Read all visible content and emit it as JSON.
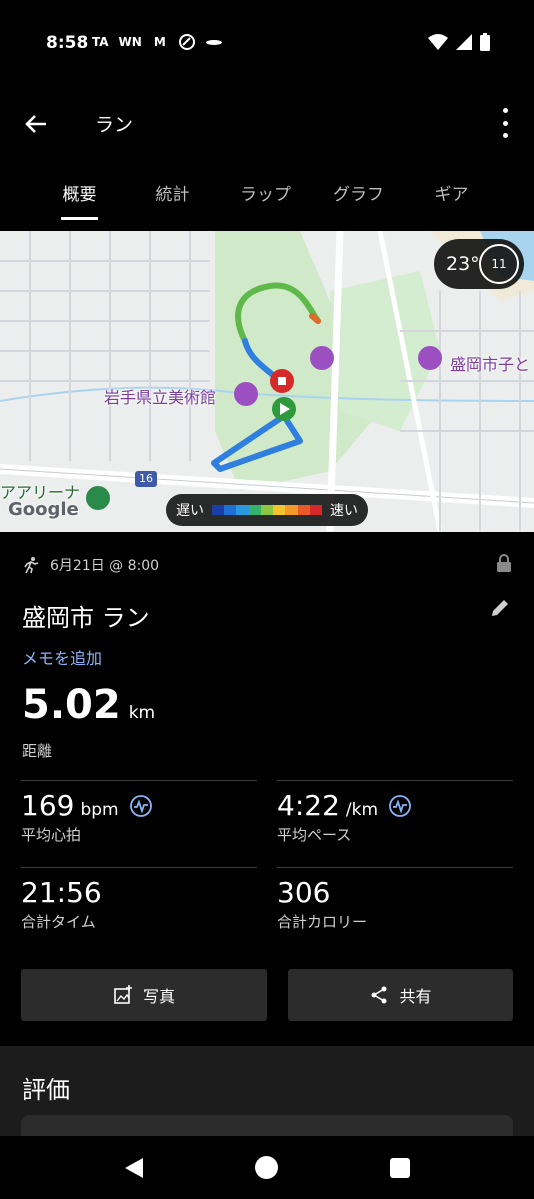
{
  "status_bar": {
    "time": "8:58",
    "icons_left": [
      "TA",
      "WN",
      "M"
    ],
    "icons_right": [
      "wifi-icon",
      "signal-icon",
      "battery-icon"
    ]
  },
  "app_bar": {
    "title": "ラン"
  },
  "tabs": [
    {
      "label": "概要",
      "active": true
    },
    {
      "label": "統計",
      "active": false
    },
    {
      "label": "ラップ",
      "active": false
    },
    {
      "label": "グラフ",
      "active": false
    },
    {
      "label": "ギア",
      "active": false
    }
  ],
  "map": {
    "weather_temp": "23°",
    "weather_dial": "11",
    "labels": {
      "museum": "岩手県立美術館",
      "city_right": "盛岡市子と",
      "arena": "アアリーナ",
      "route_number": "16"
    },
    "google_logo": "Google",
    "speed_legend": {
      "slow": "遅い",
      "fast": "速い",
      "colors": [
        "#1b3ea8",
        "#1f6fd6",
        "#2a9ae0",
        "#36b36a",
        "#8cc63f",
        "#f4c430",
        "#f39a2b",
        "#e85a2a",
        "#d62a2a"
      ]
    },
    "route_colors": {
      "slow": "#2f7fe0",
      "mid": "#5fb84a",
      "fast": "#e06a2a"
    }
  },
  "summary": {
    "date": "6月21日 @ 8:00",
    "activity_title": "盛岡市 ラン",
    "memo_link": "メモを追加",
    "distance": {
      "value": "5.02",
      "unit": "km",
      "label": "距離"
    },
    "stats": {
      "heart_rate": {
        "value": "169",
        "unit": "bpm",
        "label": "平均心拍"
      },
      "pace": {
        "value": "4:22",
        "unit": "/km",
        "label": "平均ペース"
      },
      "time": {
        "value": "21:56",
        "label": "合計タイム"
      },
      "calories": {
        "value": "306",
        "label": "合計カロリー"
      }
    },
    "buttons": {
      "photo": "写真",
      "share": "共有"
    }
  },
  "rating": {
    "title": "評価"
  }
}
